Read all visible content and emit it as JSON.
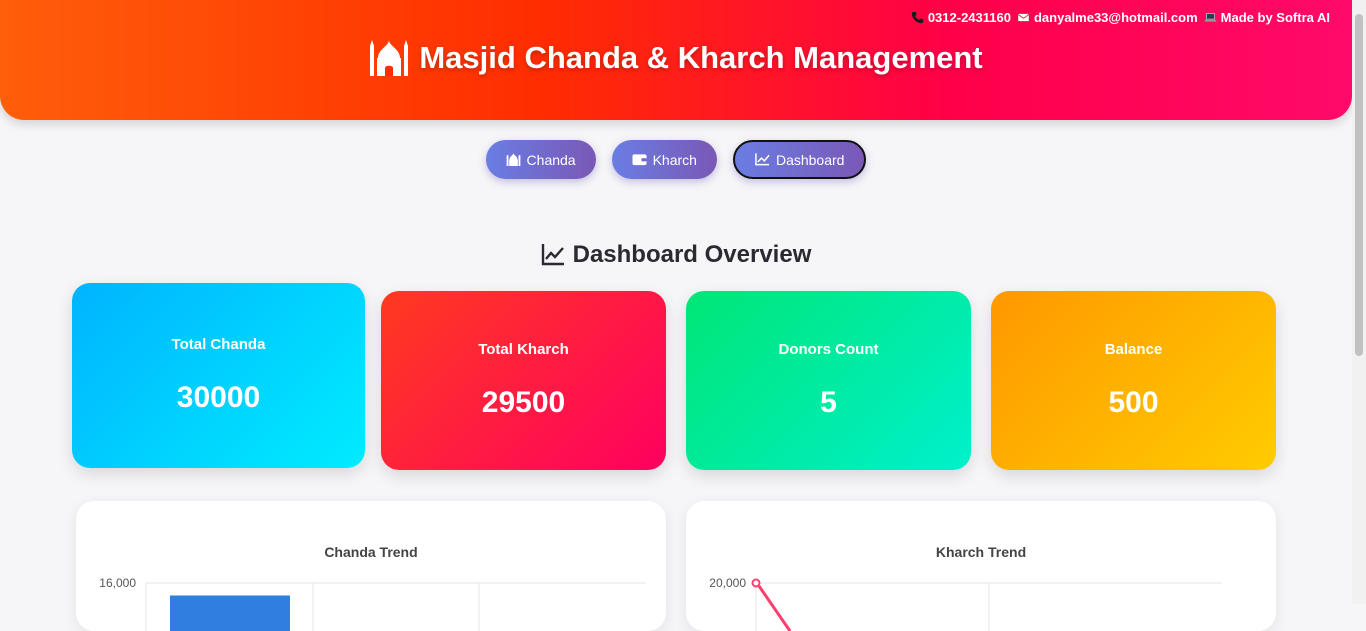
{
  "header": {
    "phone": "0312-2431160",
    "email": "danyalme33@hotmail.com",
    "credit": "Made by Softra AI",
    "title": "Masjid Chanda & Kharch Management"
  },
  "nav": {
    "chanda": "Chanda",
    "kharch": "Kharch",
    "dashboard": "Dashboard"
  },
  "section": {
    "title": "Dashboard Overview"
  },
  "stats": {
    "total_chanda": {
      "label": "Total Chanda",
      "value": "30000"
    },
    "total_kharch": {
      "label": "Total Kharch",
      "value": "29500"
    },
    "donors_count": {
      "label": "Donors Count",
      "value": "5"
    },
    "balance": {
      "label": "Balance",
      "value": "500"
    }
  },
  "colors": {
    "header_from": "#ff5e0a",
    "header_to": "#ff0a6a",
    "nav_from": "#6a7de3",
    "nav_to": "#7a58b6",
    "chanda_bar": "#2f7ee0",
    "kharch_line": "#ff3d6e"
  },
  "chart_data": [
    {
      "type": "bar",
      "title": "Chanda Trend",
      "y_tick_top": "16,000",
      "y_max": 16000,
      "values": [
        15000
      ],
      "bar_color": "#2f7ee0"
    },
    {
      "type": "line",
      "title": "Kharch Trend",
      "y_tick_top": "20,000",
      "y_max": 20000,
      "values": [
        20000
      ],
      "line_color": "#ff3d6e"
    }
  ]
}
